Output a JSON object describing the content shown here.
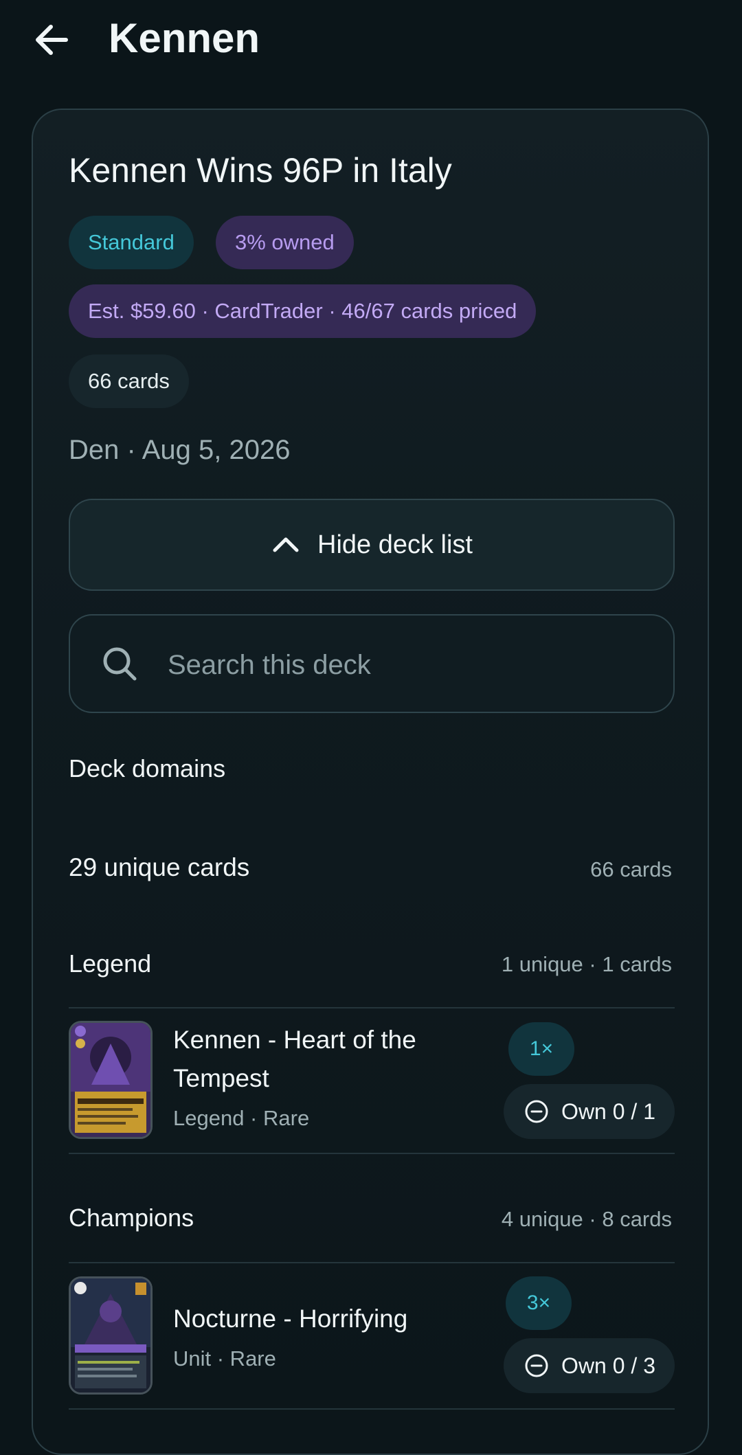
{
  "header": {
    "title": "Kennen"
  },
  "deck": {
    "title": "Kennen Wins 96P in Italy",
    "format_badge": "Standard",
    "owned_badge": "3% owned",
    "price_badge": "Est. $59.60 · CardTrader · 46/67 cards priced",
    "cards_badge": "66 cards",
    "meta": "Den · Aug 5, 2026",
    "toggle_label": "Hide deck list"
  },
  "search": {
    "placeholder": "Search this deck"
  },
  "domains": {
    "label": "Deck domains"
  },
  "summary": {
    "unique": "29 unique cards",
    "total": "66 cards"
  },
  "sections": [
    {
      "name": "Legend",
      "meta": "1 unique · 1 cards",
      "cards": [
        {
          "name": "Kennen - Heart of the Tempest",
          "type": "Legend · Rare",
          "qty": "1×",
          "own": "Own 0 / 1"
        }
      ]
    },
    {
      "name": "Champions",
      "meta": "4 unique · 8 cards",
      "cards": [
        {
          "name": "Nocturne - Horrifying",
          "type": "Unit · Rare",
          "qty": "3×",
          "own": "Own 0 / 3"
        }
      ]
    }
  ],
  "colors": {
    "background": "#0b1519",
    "accent_cyan": "#45c8d9",
    "accent_purple": "#b79cf0",
    "muted_text": "#9fb0b4"
  }
}
